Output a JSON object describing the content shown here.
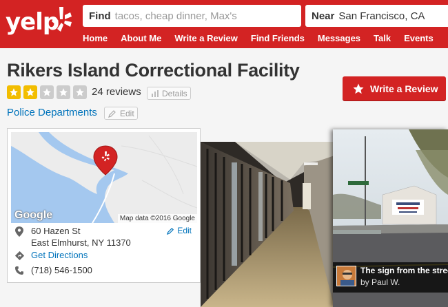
{
  "header": {
    "logo_text": "yelp",
    "find_label": "Find",
    "find_placeholder": "tacos, cheap dinner, Max's",
    "near_label": "Near",
    "near_value": "San Francisco, CA",
    "nav": [
      "Home",
      "About Me",
      "Write a Review",
      "Find Friends",
      "Messages",
      "Talk",
      "Events"
    ]
  },
  "business": {
    "name": "Rikers Island Correctional Facility",
    "rating": 2,
    "rating_max": 5,
    "reviews": "24 reviews",
    "details_label": "Details",
    "category": "Police Departments",
    "edit_label": "Edit",
    "write_review_label": "Write a Review"
  },
  "map_card": {
    "map_data": "Map data ©2016 Google",
    "google_logo": "Google",
    "address_line1": "60 Hazen St",
    "address_line2": "East Elmhurst, NY 11370",
    "edit_label": "Edit",
    "directions": "Get Directions",
    "phone": "(718) 546-1500"
  },
  "photo_caption": {
    "title": "The sign from the street",
    "by": "by Paul W."
  },
  "colors": {
    "brand_red": "#d32323",
    "star_gold": "#f2bd00",
    "link_blue": "#0073bb"
  },
  "icons": [
    "yelp-burst-icon",
    "star-icon",
    "bar-chart-icon",
    "pencil-icon",
    "map-pin-icon",
    "directions-icon",
    "phone-icon"
  ]
}
